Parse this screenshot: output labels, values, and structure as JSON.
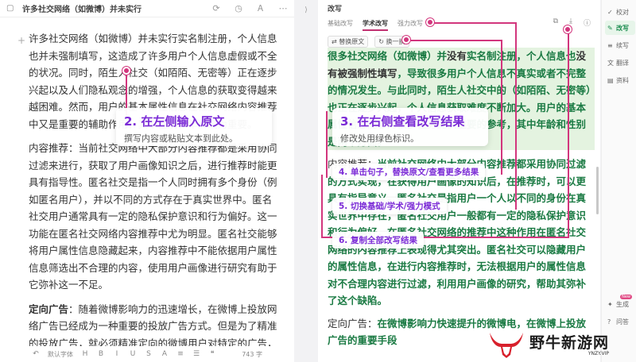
{
  "left": {
    "doc_title": "许多社交网络（如微博）并未实行实...",
    "paragraphs": [
      "许多社交网络（如微博）并未实行实名制注册，个人信息也并未强制填写，这造成了许多用户个人信息虚假或不全的状况。同时，陌生人社交（如陌陌、无密等）正在逐步兴起以及人们隐私观念的增强，个人信息的获取变得越来越困难。然而，用户的基本属性信息在社交网络内容推荐中又是重要的辅助作用，其中性别和年龄最为重要。",
      "内容推荐：当前社交网络中大部分内容推荐都是采用协同过滤来进行，获取了用户画像知识之后，进行推荐时能更具有指导性。匿名社交是指一个人同时拥有多个身份（例如匿名用户），并以不同的方式存在于真实世界中。匿名社交用户通常具有一定的隐私保护意识和行为偏好。这一功能在匿名社交网络内容推荐中尤为明显。匿名社交能够将用户属性信息隐藏起来，内容推荐中不能依据用户属性信息筛选出不合理的内容，使用用户画像进行研究有助于它弥补这一不足。"
    ],
    "p3_label": "定向广告",
    "p3_text": "：随着微博影响力的迅速增长，在微博上投放网络广告已经成为一种重要的投放广告方式。但是为了精准的投放广告，就必须精准定向的微博用户对特定的广告，乃至",
    "footer": {
      "font": "默认字体",
      "count": "743 字"
    }
  },
  "right": {
    "title": "改写",
    "tabs": [
      "基础改写",
      "学术改写",
      "强力改写"
    ],
    "actions": {
      "replace": "替换原文",
      "swap": "换一换"
    },
    "p1": [
      {
        "t": "很多社交网络（如微博）并",
        "c": "g"
      },
      {
        "t": "没有",
        "c": ""
      },
      {
        "t": "实名制注册，个人信息也",
        "c": "g"
      },
      {
        "t": "没有被强制性填写",
        "c": ""
      },
      {
        "t": "，导致很多用户个人信息不真实或者不完整的情况发生。",
        "c": "g"
      },
      {
        "t": "与此同时，陌生人社交中的（如陌陌、无密等）也正在逐步兴起，个人信息获取难度不断加大。用户的基本属性信息能够为很多任务提供重要的参考，其中年龄和性别是两个方面。",
        "c": "g"
      }
    ],
    "p2": [
      {
        "t": "内容推荐：",
        "c": "n"
      },
      {
        "t": "当前社交网络中大部分内容推荐都采用协同过滤的方式实现，在获得用户画像的知识后，在推荐时，可以更具有指导意义。匿名社交是指用户一个人以不同的身份在真实世界中存在，匿名社交用户一般都有一定的隐私保护意识和行为偏好，在匿名社交网络的推荐中这种作用在匿名社交网络的内容推荐上表现得尤其突出。匿名社交可以隐藏用户的属性信息，在进行内容推荐时，无法根据用户的属性信息对不合理内容进行过滤，利用用户画像的研究，帮助其弥补了这个缺陷。",
        "c": "g"
      }
    ],
    "p3_label": "定向广告：",
    "p3_text": "在微博影响力快速提升的微博电，在微博上投放广告的重要手段"
  },
  "sidebar": {
    "items": [
      {
        "label": "校对",
        "icon": "✓"
      },
      {
        "label": "改写",
        "icon": "✎",
        "active": true
      },
      {
        "label": "续写",
        "icon": "≡"
      },
      {
        "label": "翻译",
        "icon": "文"
      },
      {
        "label": "资料",
        "icon": "▤"
      },
      {
        "label": "生成",
        "icon": "✦",
        "badge": "New"
      },
      {
        "label": "问答",
        "icon": "?"
      }
    ]
  },
  "annotations": {
    "c2_title": "2. 在左侧输入原文",
    "c2_sub": "撰写内容或粘贴文本到此处。",
    "c3_title": "3. 在右侧查看改写结果",
    "c3_sub": "修改处用绿色标识。",
    "c4": "4. 单击句子，替换原文/查看更多结果",
    "c5": "5. 切换基础/学术/强力模式",
    "c6": "6. 复制全部改写结果"
  },
  "watermark": {
    "main": "野牛新游网",
    "sub": "YNZY.VIP"
  },
  "colors": {
    "accent": "#d2367d",
    "callout_text": "#7b2bd6",
    "green_text": "#1a7a43"
  }
}
